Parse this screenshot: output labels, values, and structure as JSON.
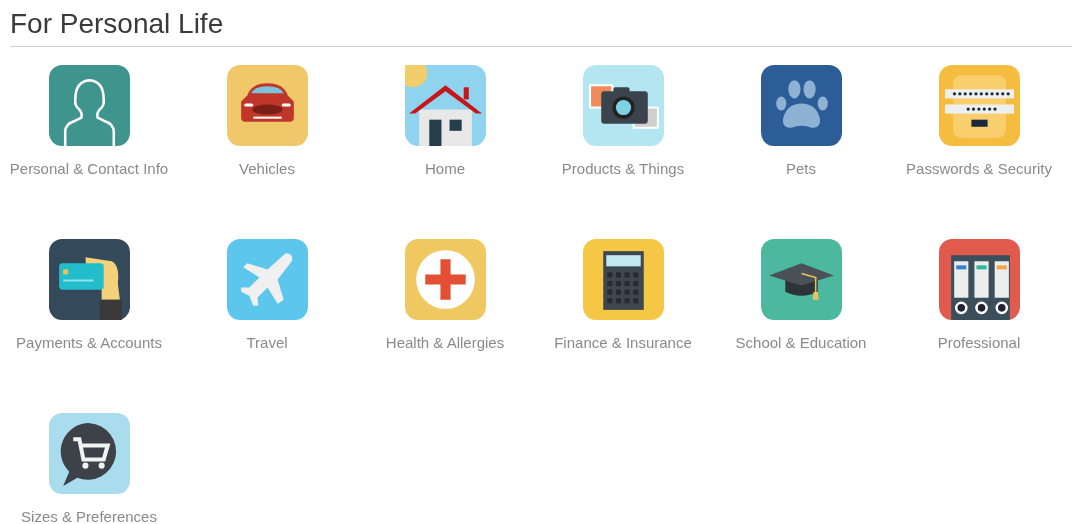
{
  "section": {
    "title": "For Personal Life"
  },
  "categories": [
    {
      "label": "Personal & Contact Info",
      "kind": "person"
    },
    {
      "label": "Vehicles",
      "kind": "car"
    },
    {
      "label": "Home",
      "kind": "house"
    },
    {
      "label": "Products & Things",
      "kind": "camera"
    },
    {
      "label": "Pets",
      "kind": "paw"
    },
    {
      "label": "Passwords & Security",
      "kind": "password"
    },
    {
      "label": "Payments & Accounts",
      "kind": "card"
    },
    {
      "label": "Travel",
      "kind": "plane"
    },
    {
      "label": "Health & Allergies",
      "kind": "medical"
    },
    {
      "label": "Finance & Insurance",
      "kind": "calculator"
    },
    {
      "label": "School & Education",
      "kind": "cap"
    },
    {
      "label": "Professional",
      "kind": "binders"
    },
    {
      "label": "Sizes & Preferences",
      "kind": "cart"
    }
  ]
}
